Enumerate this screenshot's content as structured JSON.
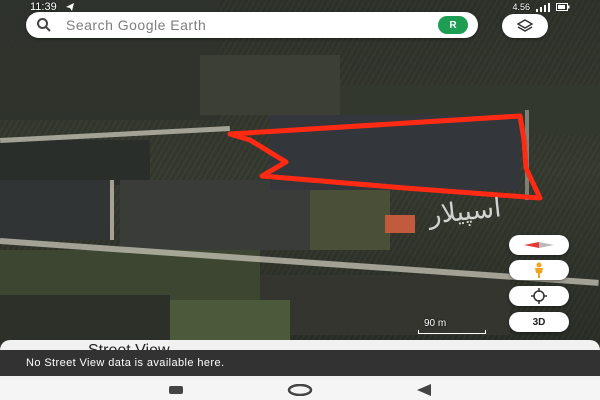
{
  "status_bar": {
    "time": "11:39",
    "network_speed": "4.56"
  },
  "search": {
    "placeholder": "Search Google Earth",
    "avatar_letter": "R"
  },
  "map_controls": {
    "view_3d_label": "3D"
  },
  "scale": {
    "label": "90 m"
  },
  "bottom_sheet": {
    "title": "Street View"
  },
  "toast": {
    "message": "No Street View data is available here."
  },
  "colors": {
    "parcel_outline": "#ff2a14",
    "avatar_bg": "#1e9e52",
    "compass_red": "#e53935",
    "pegman": "#f4a21d"
  },
  "icons": {
    "search": "search-icon",
    "layers": "layers-icon",
    "compass": "compass-icon",
    "pegman": "pegman-icon",
    "my_location": "my-location-icon",
    "nav_back": "nav-back-icon",
    "nav_home": "nav-home-icon",
    "nav_recents": "nav-recents-icon"
  },
  "watermark": {
    "text": "اسپیلار"
  }
}
